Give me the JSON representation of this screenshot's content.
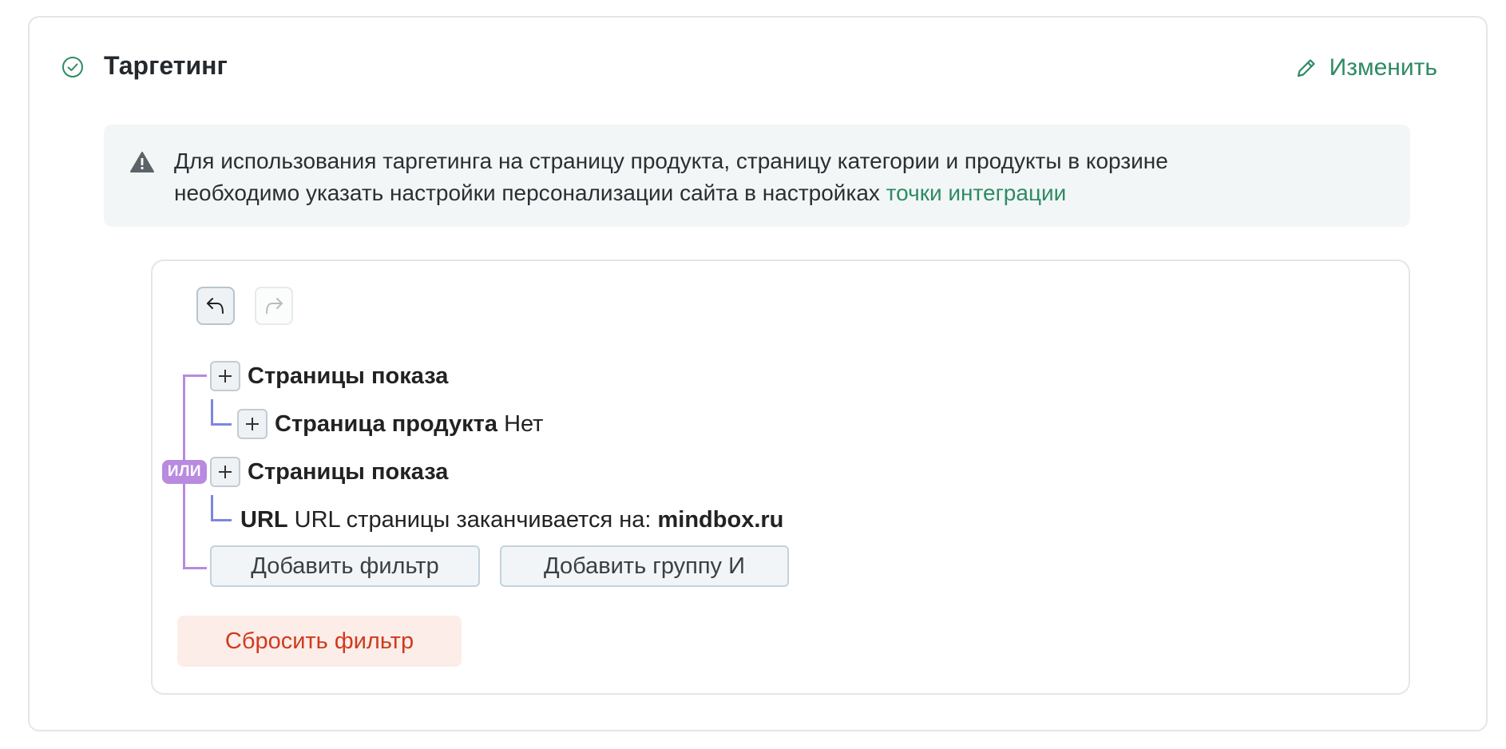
{
  "section": {
    "title": "Таргетинг",
    "edit_label": "Изменить"
  },
  "notice": {
    "text_line1": "Для использования таргетинга на страницу продукта, страницу категории и продукты в корзине",
    "text_line2": "необходимо указать настройки персонализации сайта в настройках ",
    "link_text": "точки интеграции"
  },
  "filter": {
    "operator_badge": "ИЛИ",
    "groups": [
      {
        "title": "Страницы показа",
        "condition_name": "Страница продукта",
        "condition_value": "Нет"
      },
      {
        "title": "Страницы показа",
        "condition_name": "URL",
        "condition_text": "URL страницы заканчивается на:",
        "condition_value": "mindbox.ru"
      }
    ],
    "add_filter_label": "Добавить фильтр",
    "add_group_label": "Добавить группу И",
    "reset_label": "Сбросить фильтр"
  },
  "colors": {
    "accent_green": "#2e8b63",
    "or_purple": "#b88ae0",
    "and_blue": "#7c86e3",
    "danger_red": "#d03a1c"
  }
}
